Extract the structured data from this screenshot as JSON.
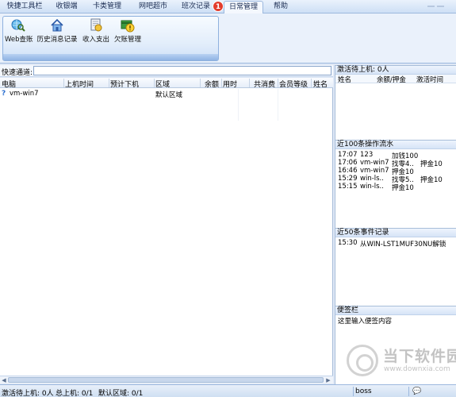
{
  "tabs": [
    {
      "label": "快捷工具栏"
    },
    {
      "label": "收银端"
    },
    {
      "label": "卡类管理"
    },
    {
      "label": "网吧超市"
    },
    {
      "label": "班次记录"
    },
    {
      "label": "日常管理"
    },
    {
      "label": "帮助"
    }
  ],
  "active_tab": "日常管理",
  "badge": "1",
  "ribbon": {
    "buttons": [
      {
        "label": "Web查账",
        "icon": "web-query-icon"
      },
      {
        "label": "历史消息记录",
        "icon": "home-icon"
      },
      {
        "label": "收入支出",
        "icon": "income-expense-icon"
      },
      {
        "label": "欠账管理",
        "icon": "debt-warning-icon"
      }
    ]
  },
  "quick_channel": {
    "label": "快速通道:",
    "value": ""
  },
  "table": {
    "headers": [
      "电脑",
      "上机时间",
      "预计下机",
      "区域",
      "余额",
      "用时",
      "共消费",
      "会员等级",
      "姓名"
    ],
    "rows": [
      {
        "computer": "vm-win7",
        "start": "",
        "expected_end": "",
        "area": "默认区域",
        "balance": "",
        "used": "",
        "total": "",
        "level": "",
        "name": ""
      }
    ]
  },
  "right_panel": {
    "pending": {
      "title": "激活待上机: 0人",
      "headers": [
        "姓名",
        "余额/押金",
        "激活时间"
      ]
    },
    "operations": {
      "title": "近100条操作流水",
      "rows": [
        {
          "time": "17:07",
          "who": "123",
          "action": "加钱100",
          "extra": ""
        },
        {
          "time": "17:06",
          "who": "vm-win7",
          "action": "找零4..",
          "extra": "押金10"
        },
        {
          "time": "16:46",
          "who": "vm-win7",
          "action": "押金10",
          "extra": ""
        },
        {
          "time": "15:29",
          "who": "win-ls..",
          "action": "找零5..",
          "extra": "押金10"
        },
        {
          "time": "15:15",
          "who": "win-ls..",
          "action": "押金10",
          "extra": ""
        }
      ]
    },
    "events": {
      "title": "近50条事件记录",
      "rows": [
        {
          "time": "15:30",
          "text": "从WIN-LST1MUF30NU解锁"
        }
      ]
    },
    "notes": {
      "title": "便签栏",
      "placeholder": "这里输入便签内容"
    }
  },
  "status": {
    "pending": "激活待上机: 0人",
    "total_online": "总上机: 0/1",
    "area": "默认区域: 0/1",
    "user": "boss"
  },
  "watermark": {
    "text": "当下软件园",
    "sub": "www.downxia.com"
  },
  "colors": {
    "accent": "#e23c2c",
    "frame": "#9cb8de"
  }
}
